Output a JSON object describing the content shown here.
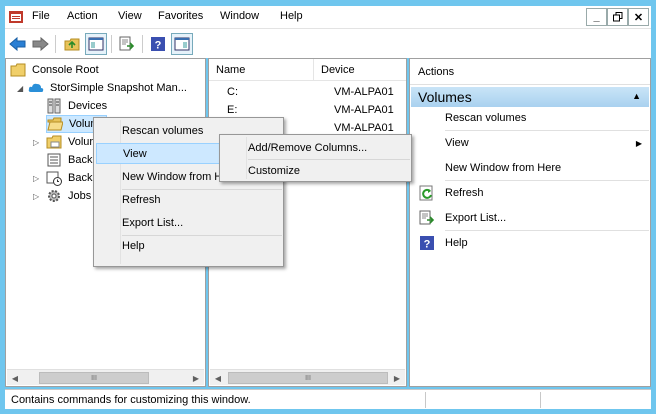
{
  "menubar": {
    "items": [
      "File",
      "Action",
      "View",
      "Favorites",
      "Window",
      "Help"
    ]
  },
  "toolbar": {
    "buttons": [
      "back-icon",
      "forward-icon",
      "up-folder-icon",
      "show-hide-console-tree-icon",
      "export-list-icon",
      "help-icon",
      "show-hide-action-pane-icon"
    ]
  },
  "tree": {
    "root": "Console Root",
    "snapin": "StorSimple Snapshot Man...",
    "items": [
      {
        "label": "Devices"
      },
      {
        "label": "Volum"
      },
      {
        "label": "Volur"
      },
      {
        "label": "Backu"
      },
      {
        "label": "Backu"
      },
      {
        "label": "Jobs"
      }
    ]
  },
  "list": {
    "columns": [
      "Name",
      "Device"
    ],
    "rows": [
      {
        "name": "C:",
        "device": "VM-ALPA01"
      },
      {
        "name": "E:",
        "device": "VM-ALPA01"
      },
      {
        "name": "",
        "device": "VM-ALPA01"
      }
    ]
  },
  "actions": {
    "header": "Actions",
    "section": "Volumes",
    "items": [
      {
        "label": "Rescan volumes"
      },
      {
        "label": "View"
      },
      {
        "label": "New Window from Here"
      },
      {
        "label": "Refresh"
      },
      {
        "label": "Export List..."
      },
      {
        "label": "Help"
      }
    ]
  },
  "context_menu": {
    "items": [
      {
        "label": "Rescan volumes"
      },
      {
        "label": "View"
      },
      {
        "label": "New Window from Here"
      },
      {
        "label": "Refresh"
      },
      {
        "label": "Export List..."
      },
      {
        "label": "Help"
      }
    ],
    "submenu": [
      {
        "label": "Add/Remove Columns..."
      },
      {
        "label": "Customize"
      }
    ]
  },
  "status": {
    "text": "Contains commands for customizing this window."
  },
  "colors": {
    "frame": "#6fc6ee",
    "highlight": "#cde8ff",
    "section_header": "#b9dbf3"
  }
}
